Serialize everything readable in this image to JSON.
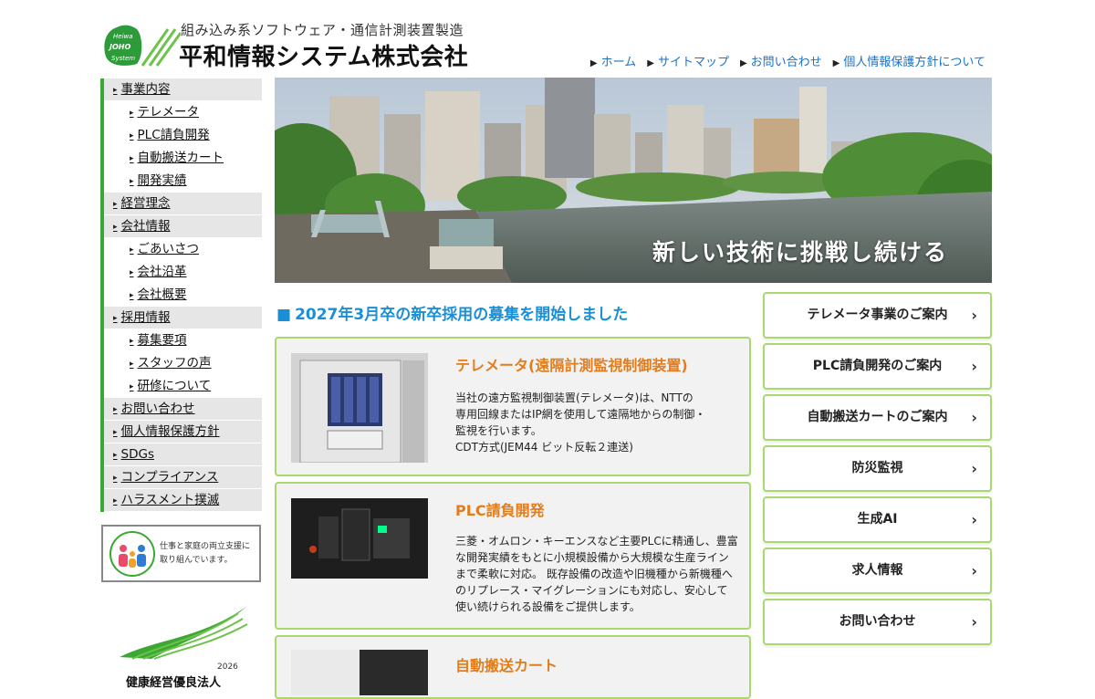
{
  "header": {
    "logo_text": [
      "Heiwa",
      "JOHO",
      "System"
    ],
    "tagline": "組み込み系ソフトウェア・通信計測装置製造",
    "company": "平和情報システム株式会社",
    "nav": [
      "ホーム",
      "サイトマップ",
      "お問い合わせ",
      "個人情報保護方針について"
    ]
  },
  "sidebar": {
    "items": [
      {
        "label": "事業内容",
        "level": "main"
      },
      {
        "label": "テレメータ",
        "level": "sub"
      },
      {
        "label": "PLC請負開発",
        "level": "sub"
      },
      {
        "label": "自動搬送カート",
        "level": "sub"
      },
      {
        "label": "開発実績",
        "level": "sub"
      },
      {
        "label": "経営理念",
        "level": "main"
      },
      {
        "label": "会社情報",
        "level": "main"
      },
      {
        "label": "ごあいさつ",
        "level": "sub"
      },
      {
        "label": "会社沿革",
        "level": "sub"
      },
      {
        "label": "会社概要",
        "level": "sub"
      },
      {
        "label": "採用情報",
        "level": "main"
      },
      {
        "label": "募集要項",
        "level": "sub"
      },
      {
        "label": "スタッフの声",
        "level": "sub"
      },
      {
        "label": "研修について",
        "level": "sub"
      },
      {
        "label": "お問い合わせ",
        "level": "main"
      },
      {
        "label": "個人情報保護方針",
        "level": "main"
      },
      {
        "label": "SDGs",
        "level": "main"
      },
      {
        "label": "コンプライアンス",
        "level": "main"
      },
      {
        "label": "ハラスメント撲滅",
        "level": "main"
      }
    ],
    "badge1_text": "仕事と家庭の両立支援に\n取り組んでいます。",
    "badge2_year": "2026",
    "badge2_label": "健康経営優良法人"
  },
  "hero": {
    "caption": "新しい技術に挑戦し続ける"
  },
  "news": {
    "headline": "2027年3月卒の新卒採用の募集を開始しました"
  },
  "cards": [
    {
      "title": "テレメータ(遠隔計測監視制御装置)",
      "body": "当社の遠方監視制御装置(テレメータ)は、NTTの\n専用回線またはIP網を使用して遠隔地からの制御・\n監視を行います。\nCDT方式(JEM44 ビット反転２連送)"
    },
    {
      "title": "PLC請負開発",
      "body": "三菱・オムロン・キーエンスなど主要PLCに精通し、豊富な開発実績をもとに小規模設備から大規模な生産ラインまで柔軟に対応。 既存設備の改造や旧機種から新機種へのリプレース・マイグレーションにも対応し、安心して使い続けられる設備をご提供します。"
    },
    {
      "title": "自動搬送カート",
      "body": ""
    }
  ],
  "right_buttons": [
    "テレメータ事業のご案内",
    "PLC請負開発のご案内",
    "自動搬送カートのご案内",
    "防災監視",
    "生成AI",
    "求人情報",
    "お問い合わせ"
  ],
  "colors": {
    "accent_green": "#3aa832",
    "card_border": "#a8d86e",
    "link_blue": "#1a73c9",
    "headline_blue": "#1a8fd6",
    "card_title_orange": "#e37c1a"
  }
}
